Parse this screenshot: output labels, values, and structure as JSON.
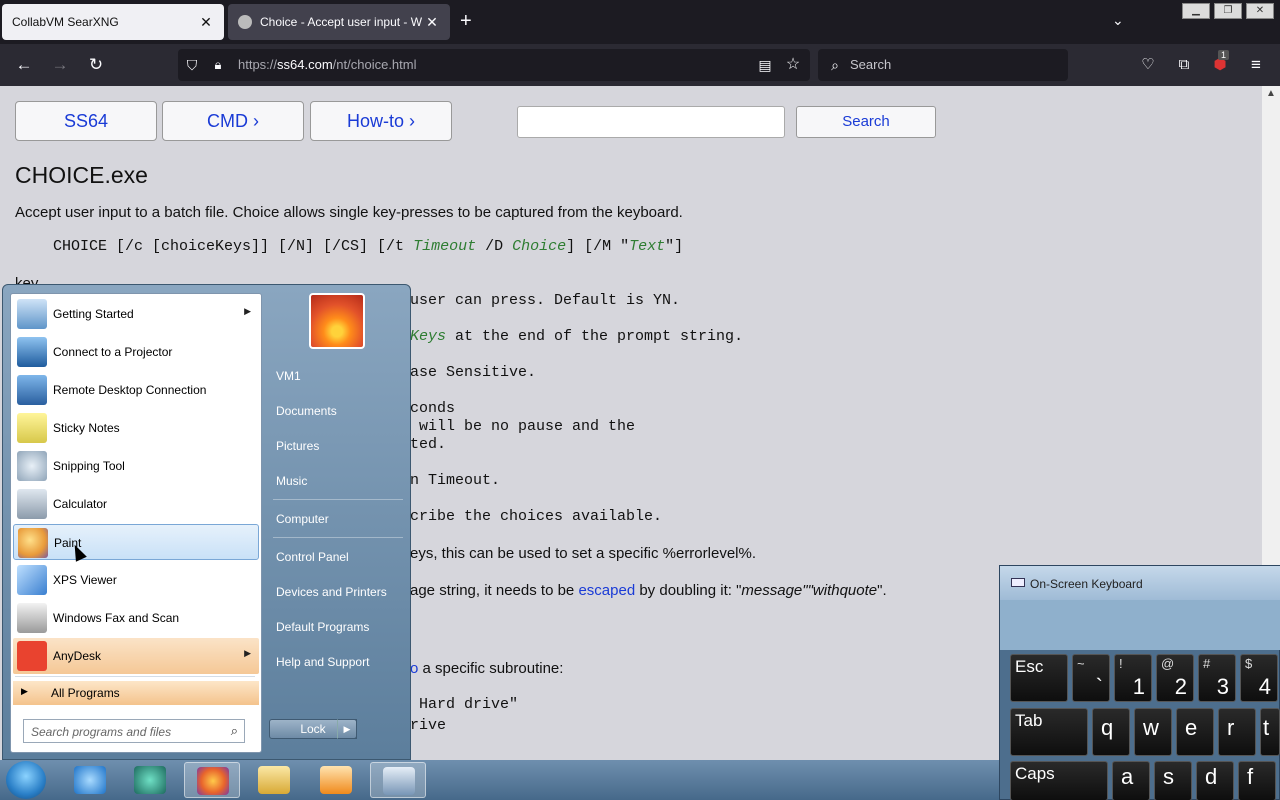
{
  "browser": {
    "tabs": [
      {
        "title": "CollabVM SearXNG"
      },
      {
        "title": "Choice - Accept user input - W"
      }
    ],
    "url_prefix": "https://",
    "url_host": "ss64.com",
    "url_path": "/nt/choice.html",
    "search_placeholder": "Search",
    "notification_count": "1"
  },
  "page": {
    "nav_buttons": [
      "SS64",
      "CMD ›",
      "How-to ›"
    ],
    "search_button": "Search",
    "title": "CHOICE.exe",
    "intro": "Accept user input to a batch file. Choice allows single key-presses to be captured from the keyboard.",
    "syntax_parts": {
      "p1": "CHOICE [/c [choiceKeys]] [/N] [/CS] [/t ",
      "timeout": "Timeout",
      "p2": " /D ",
      "choice": "Choice",
      "p3": "] [/M \"",
      "text": "Text",
      "p4": "\"]"
    },
    "key_label": "key",
    "lines": {
      "l1": "user can press. Default is YN.",
      "l2_it": "Keys",
      "l2": " at the end of the prompt string.",
      "l3": "ase Sensitive.",
      "l4": "conds",
      "l5": " will be no pause and the",
      "l6": "ted.",
      "l7": "n Timeout.",
      "l8": "cribe the choices available.",
      "l9": "eys, this can be used to set a specific %errorlevel%.",
      "l10a": "age string, it needs to be ",
      "l10link": "escaped",
      "l10b": " by doubling it: \"",
      "l10it": "message\"\"withquote",
      "l10c": "\".",
      "l11link": "o",
      "l11": " a specific subroutine:",
      "l12": " Hard drive\"",
      "l13": "rive"
    }
  },
  "start_menu": {
    "programs": [
      {
        "label": "Getting Started",
        "has_arrow": true,
        "icon": "getting-started-icon"
      },
      {
        "label": "Connect to a Projector",
        "icon": "projector-icon"
      },
      {
        "label": "Remote Desktop Connection",
        "icon": "remote-desktop-icon"
      },
      {
        "label": "Sticky Notes",
        "icon": "sticky-notes-icon"
      },
      {
        "label": "Snipping Tool",
        "icon": "scissors-icon"
      },
      {
        "label": "Calculator",
        "icon": "calculator-icon"
      },
      {
        "label": "Paint",
        "icon": "paint-icon"
      },
      {
        "label": "XPS Viewer",
        "icon": "xps-viewer-icon"
      },
      {
        "label": "Windows Fax and Scan",
        "icon": "fax-icon"
      },
      {
        "label": "AnyDesk",
        "has_arrow": true,
        "icon": "anydesk-icon"
      }
    ],
    "all_programs": "All Programs",
    "search_placeholder": "Search programs and files",
    "right_items": [
      "VM1",
      "Documents",
      "Pictures",
      "Music",
      "Computer",
      "Control Panel",
      "Devices and Printers",
      "Default Programs",
      "Help and Support"
    ],
    "lock_label": "Lock"
  },
  "taskbar": {
    "items": [
      "start-orb",
      "internet-explorer-icon",
      "media-icon",
      "firefox-icon",
      "explorer-icon",
      "media-player-icon",
      "on-screen-keyboard-icon"
    ]
  },
  "osk": {
    "title": "On-Screen Keyboard",
    "row1": [
      {
        "main": "Esc"
      },
      {
        "shift": "~",
        "main": "`"
      },
      {
        "shift": "!",
        "main": "1"
      },
      {
        "shift": "@",
        "main": "2"
      },
      {
        "shift": "#",
        "main": "3"
      },
      {
        "shift": "$",
        "main": "4"
      }
    ],
    "row2": [
      {
        "main": "Tab"
      },
      {
        "main": "q"
      },
      {
        "main": "w"
      },
      {
        "main": "e"
      },
      {
        "main": "r"
      },
      {
        "main": "t"
      }
    ],
    "row3": [
      {
        "main": "Caps"
      },
      {
        "main": "a"
      },
      {
        "main": "s"
      },
      {
        "main": "d"
      },
      {
        "main": "f"
      }
    ]
  },
  "colors": {
    "link": "#1a3bd6",
    "italic_param": "#2e7d32",
    "tab_dark": "#1c1b22",
    "startmenu_blue": "#5c7e9c",
    "anydesk_red": "#e9432f"
  }
}
